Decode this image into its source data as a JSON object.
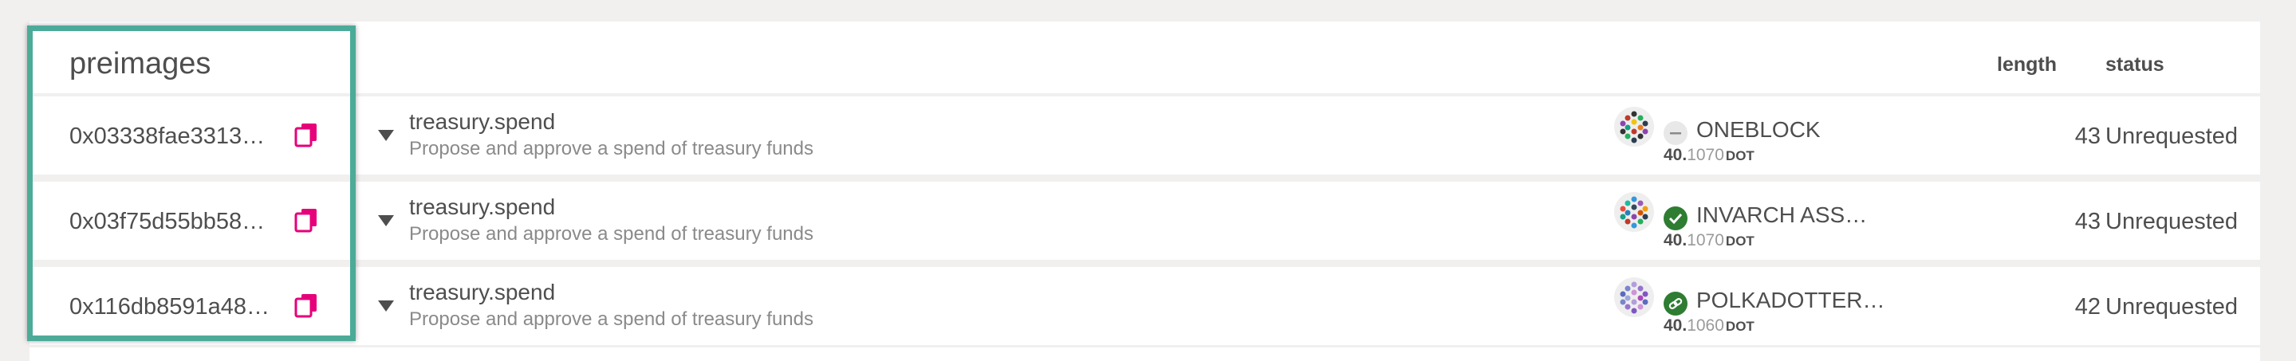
{
  "table": {
    "title": "preimages",
    "columns": {
      "length": "length",
      "status": "status"
    },
    "rows": [
      {
        "hash": "0x03338fae3313…",
        "method": "treasury.spend",
        "description": "Propose and approve a spend of treasury funds",
        "account": {
          "name": "ONEBLOCK",
          "badge": "none",
          "amount_whole": "40.",
          "amount_frac": "1070",
          "unit": "DOT"
        },
        "length": "43",
        "status": "Unrequested"
      },
      {
        "hash": "0x03f75d55bb58…",
        "method": "treasury.spend",
        "description": "Propose and approve a spend of treasury funds",
        "account": {
          "name": "INVARCH ASS…",
          "badge": "verified",
          "amount_whole": "40.",
          "amount_frac": "1070",
          "unit": "DOT"
        },
        "length": "43",
        "status": "Unrequested"
      },
      {
        "hash": "0x116db8591a48…",
        "method": "treasury.spend",
        "description": "Propose and approve a spend of treasury funds",
        "account": {
          "name": "POLKADOTTER…",
          "badge": "linked",
          "amount_whole": "40.",
          "amount_frac": "1060",
          "unit": "DOT"
        },
        "length": "42",
        "status": "Unrequested"
      }
    ]
  },
  "icons": {
    "copy": "copy-icon",
    "caret": "caret-down-icon",
    "identicon": "identicon",
    "badge_none": "minus-circle-icon",
    "badge_verified": "check-circle-icon",
    "badge_linked": "link-circle-icon"
  },
  "colors": {
    "accent": "#e6007a",
    "highlight_border": "#4cab98",
    "verified_green": "#2e7d32",
    "background": "#f1f0ef"
  }
}
